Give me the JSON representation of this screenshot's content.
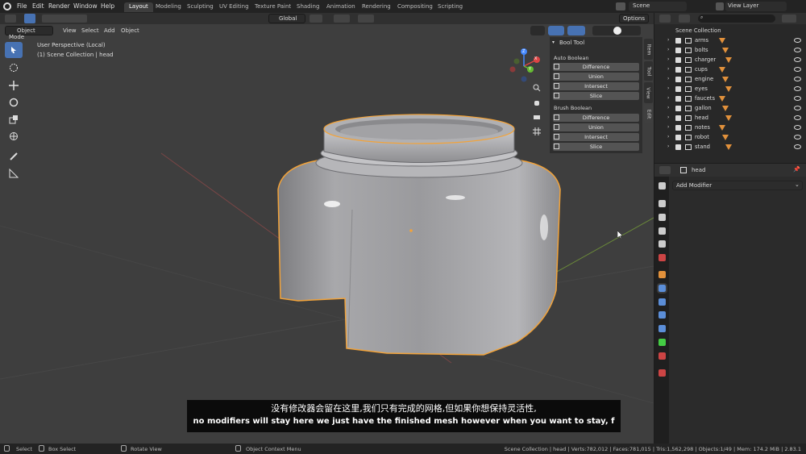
{
  "menubar": {
    "items": [
      "File",
      "Edit",
      "Render",
      "Window",
      "Help"
    ],
    "workspaces": [
      "Layout",
      "Modeling",
      "Sculpting",
      "UV Editing",
      "Texture Paint",
      "Shading",
      "Animation",
      "Rendering",
      "Compositing",
      "Scripting"
    ],
    "active_workspace": "Layout",
    "scene_name": "Scene",
    "view_layer": "View Layer"
  },
  "viewport_header": {
    "mode": "Object Mode",
    "menus": [
      "View",
      "Select",
      "Add",
      "Object"
    ],
    "transform_orientation": "Global",
    "options_label": "Options"
  },
  "viewport_info": {
    "line1": "User Perspective (Local)",
    "line2": "(1) Scene Collection | head"
  },
  "gizmo": {
    "x": "X",
    "y": "Y",
    "z": "Z"
  },
  "bool_tool": {
    "title": "Bool Tool",
    "auto_boolean": {
      "label": "Auto Boolean",
      "buttons": [
        "Difference",
        "Union",
        "Intersect",
        "Slice"
      ]
    },
    "brush_boolean": {
      "label": "Brush Boolean",
      "buttons": [
        "Difference",
        "Union",
        "Intersect",
        "Slice"
      ]
    }
  },
  "side_tabs": [
    "Item",
    "Tool",
    "View",
    "Edit"
  ],
  "outliner": {
    "root": "Scene Collection",
    "items": [
      "arms",
      "bolts",
      "charger",
      "cups",
      "engine",
      "eyes",
      "faucets",
      "gallon",
      "head",
      "notes",
      "robot",
      "stand"
    ]
  },
  "properties": {
    "object_name": "head",
    "add_modifier": "Add Modifier"
  },
  "subtitles": {
    "chinese": "没有修改器会留在这里,我们只有完成的网格,但如果你想保持灵活性,",
    "english": "no modifiers will stay here we just have the finished mesh however when you want to stay, f"
  },
  "statusbar": {
    "select": "Select",
    "box_select": "Box Select",
    "rotate_view": "Rotate View",
    "context_menu": "Object Context Menu",
    "stats": "Scene Collection | head | Verts:782,012 | Faces:781,015 | Tris:1,562,298 | Objects:1/49 | Mem: 174.2 MiB | 2.83.1"
  },
  "colors": {
    "accent": "#4772b3",
    "selection_outline": "#f2a33a",
    "viewport_bg": "#3e3e3e"
  }
}
